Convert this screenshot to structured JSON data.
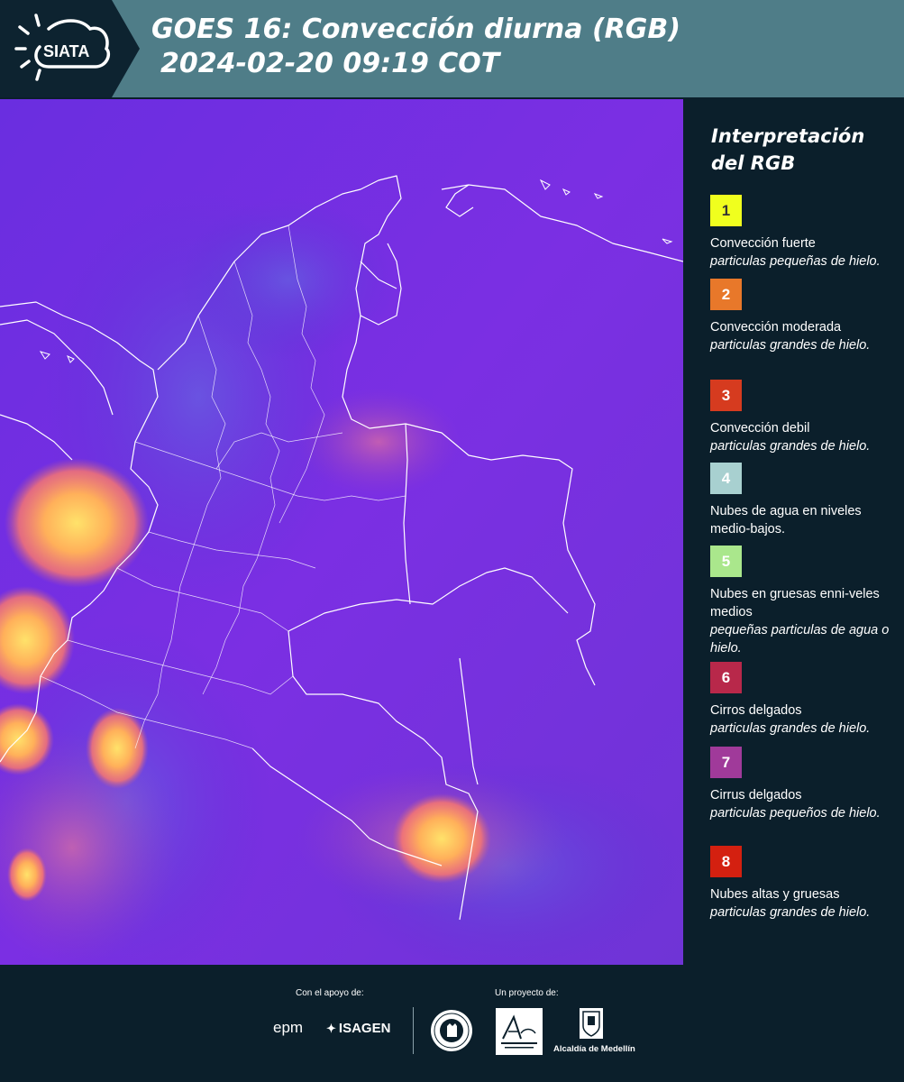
{
  "header": {
    "logo_text": "SIATA",
    "title_line1": "GOES 16: Convección diurna (RGB)",
    "title_line2": "2024-02-20 09:19 COT"
  },
  "legend": {
    "title_line1": "Interpretación",
    "title_line2": "del RGB",
    "items": [
      {
        "num": "1",
        "color": "#f0ff1e",
        "num_color": "#333333",
        "name": "Convección fuerte",
        "desc": "particulas pequeñas de hielo."
      },
      {
        "num": "2",
        "color": "#e8782a",
        "num_color": "#ffffff",
        "name": "Convección moderada",
        "desc": "particulas grandes de hielo."
      },
      {
        "num": "3",
        "color": "#d63b1f",
        "num_color": "#ffffff",
        "name": "Convección debil",
        "desc": "particulas grandes de hielo."
      },
      {
        "num": "4",
        "color": "#a8d0d0",
        "num_color": "#ffffff",
        "name": "Nubes de agua en niveles medio-bajos.",
        "desc": ""
      },
      {
        "num": "5",
        "color": "#aae78c",
        "num_color": "#ffffff",
        "name": "Nubes en gruesas enni-veles medios",
        "desc": "pequeñas particulas de agua o hielo."
      },
      {
        "num": "6",
        "color": "#b8284a",
        "num_color": "#ffffff",
        "name": "Cirros delgados",
        "desc": "particulas grandes de hielo."
      },
      {
        "num": "7",
        "color": "#a03a9a",
        "num_color": "#ffffff",
        "name": "Cirrus delgados",
        "desc": "particulas pequeños de hielo."
      },
      {
        "num": "8",
        "color": "#d42010",
        "num_color": "#ffffff",
        "name": "Nubes altas y gruesas",
        "desc": "particulas grandes de hielo."
      }
    ]
  },
  "footer": {
    "support_label": "Con el apoyo de:",
    "project_label": "Un proyecto de:",
    "epm": "epm",
    "isagen": "ISAGEN",
    "alcaldia": "Alcaldía de Medellín"
  }
}
